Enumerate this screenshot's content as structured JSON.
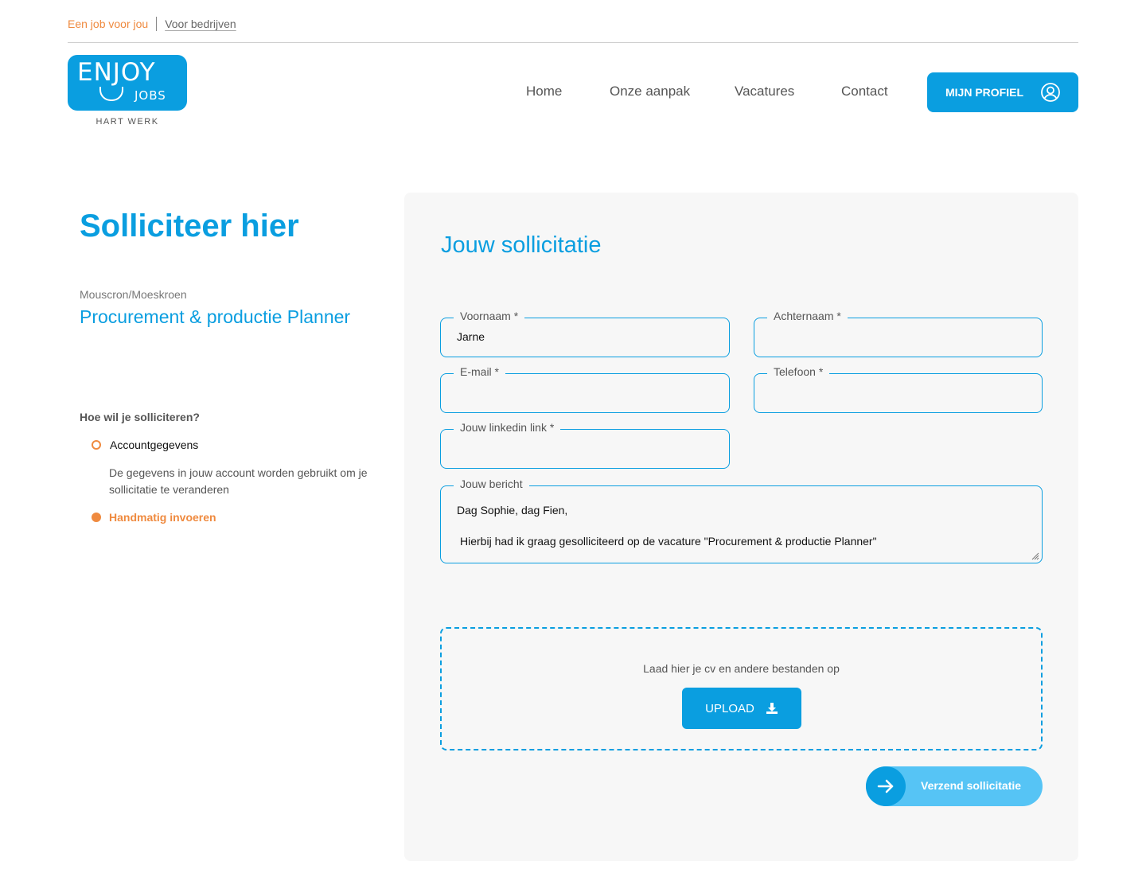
{
  "topbar": {
    "active_link": "Een job voor jou",
    "other_link": "Voor bedrijven"
  },
  "logo": {
    "word1": "ENJOY",
    "word2": "JOBS",
    "tagline": "HART WERK"
  },
  "nav": {
    "items": [
      "Home",
      "Onze aanpak",
      "Vacatures",
      "Contact"
    ],
    "profile_button": "MIJN PROFIEL"
  },
  "colors": {
    "brand": "#0a9ee0",
    "accent": "#ef8a3f",
    "panel_bg": "#f7f7f7"
  },
  "left": {
    "title": "Solliciteer hier",
    "location": "Mouscron/Moeskroen",
    "job_title": "Procurement & productie Planner",
    "how_label": "Hoe wil je solliciteren?",
    "option1_label": "Accountgegevens",
    "option1_desc": "De gegevens in jouw account worden gebruikt om je sollicitatie te veranderen",
    "option2_label": "Handmatig invoeren",
    "selected_option": "Handmatig invoeren"
  },
  "form": {
    "title": "Jouw sollicitatie",
    "firstname": {
      "label": "Voornaam *",
      "value": "Jarne"
    },
    "lastname": {
      "label": "Achternaam *",
      "value": ""
    },
    "email": {
      "label": "E-mail *",
      "value": ""
    },
    "phone": {
      "label": "Telefoon *",
      "value": ""
    },
    "linkedin": {
      "label": "Jouw linkedin link *",
      "value": ""
    },
    "message": {
      "label": "Jouw bericht",
      "line1": "Dag Sophie, dag Fien,",
      "line2": "Hierbij had ik graag gesolliciteerd op de vacature \"Procurement & productie Planner\""
    },
    "upload": {
      "text": "Laad hier je cv en andere bestanden op",
      "button": "UPLOAD"
    },
    "submit": "Verzend sollicitatie"
  }
}
